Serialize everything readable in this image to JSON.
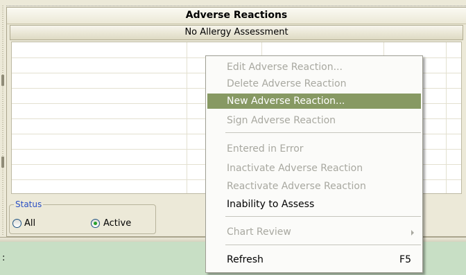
{
  "panel": {
    "title": "Adverse Reactions",
    "assessment_label": "No Allergy Assessment"
  },
  "status": {
    "legend": "Status",
    "options": [
      {
        "label": "All",
        "selected": false
      },
      {
        "label": "Active",
        "selected": true
      }
    ]
  },
  "context_menu": {
    "items": [
      {
        "label": "Edit Adverse Reaction...",
        "enabled": false
      },
      {
        "label": "Delete Adverse Reaction",
        "enabled": false
      },
      {
        "label": "New Adverse Reaction...",
        "enabled": true,
        "highlighted": true
      },
      {
        "label": "Sign Adverse Reaction",
        "enabled": false
      },
      {
        "label": "Entered in Error",
        "enabled": false
      },
      {
        "label": "Inactivate Adverse Reaction",
        "enabled": false
      },
      {
        "label": "Reactivate Adverse Reaction",
        "enabled": false
      },
      {
        "label": "Inability to Assess",
        "enabled": true
      },
      {
        "label": "Chart Review",
        "enabled": false,
        "submenu": true
      },
      {
        "label": "Refresh",
        "enabled": true,
        "shortcut": "F5"
      }
    ]
  },
  "bottom": {
    "fragment_text": ":"
  },
  "colors": {
    "highlight": "#879963",
    "disabled_text": "#a8a8a0",
    "bottom_background": "#c8dfc5",
    "legend_text": "#2a4fc4"
  }
}
